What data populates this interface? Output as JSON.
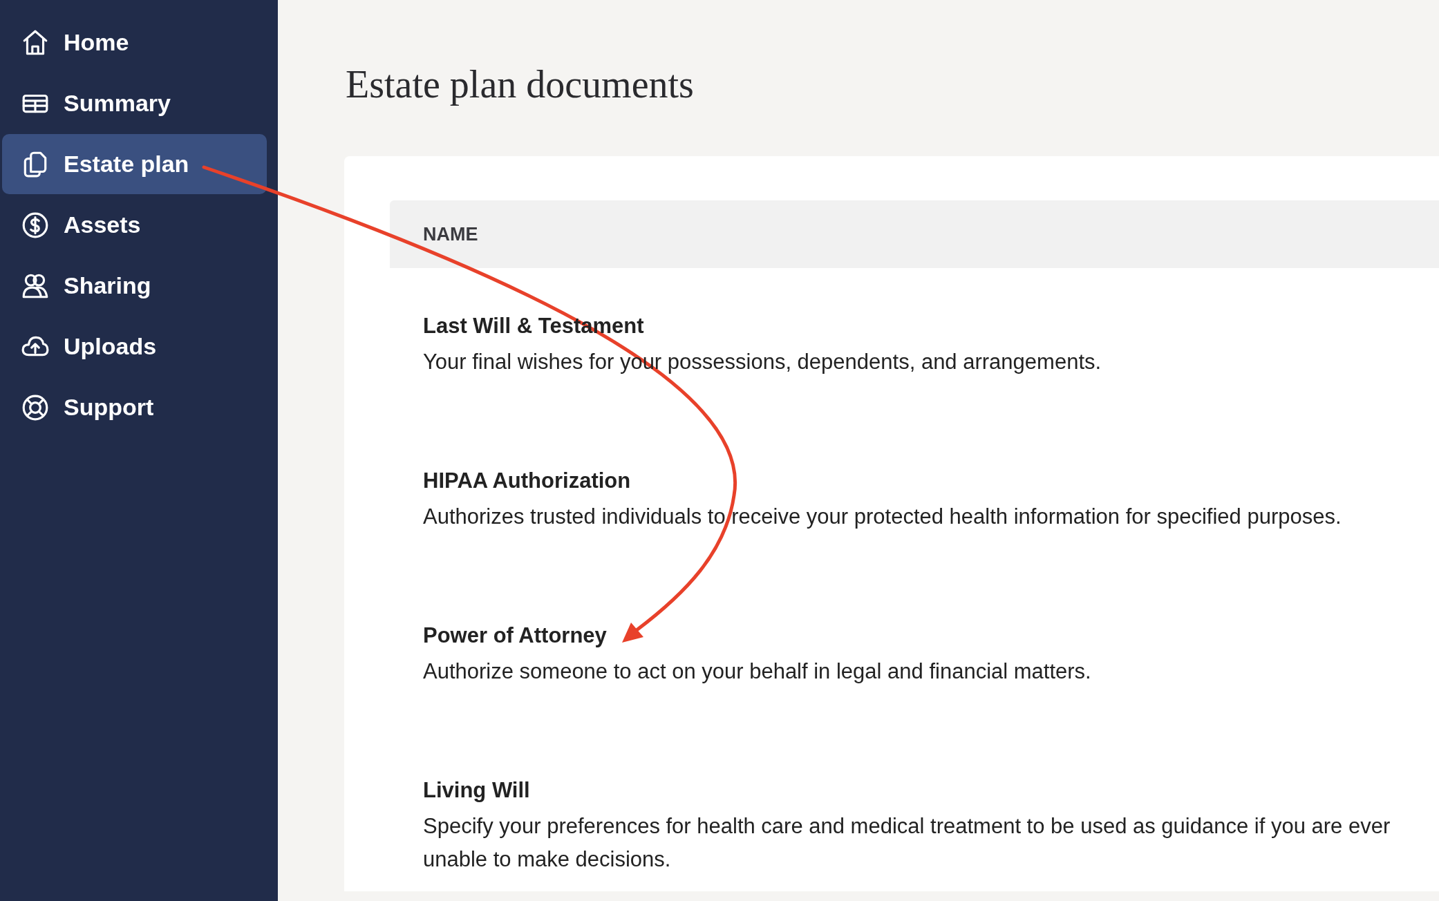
{
  "sidebar": {
    "items": [
      {
        "label": "Home",
        "selected": false
      },
      {
        "label": "Summary",
        "selected": false
      },
      {
        "label": "Estate plan",
        "selected": true
      },
      {
        "label": "Assets",
        "selected": false
      },
      {
        "label": "Sharing",
        "selected": false
      },
      {
        "label": "Uploads",
        "selected": false
      },
      {
        "label": "Support",
        "selected": false
      }
    ]
  },
  "page": {
    "title": "Estate plan documents"
  },
  "table": {
    "columns": [
      "NAME"
    ],
    "rows": [
      {
        "name": "Last Will & Testament",
        "description": "Your final wishes for your possessions, dependents, and arrangements."
      },
      {
        "name": "HIPAA Authorization",
        "description": "Authorizes trusted individuals to receive your protected health information for specified purposes."
      },
      {
        "name": "Power of Attorney",
        "description": "Authorize someone to act on your behalf in legal and financial matters."
      },
      {
        "name": "Living Will",
        "description": "Specify your preferences for health care and medical treatment to be used as guidance if you are ever unable to make decisions."
      }
    ]
  }
}
